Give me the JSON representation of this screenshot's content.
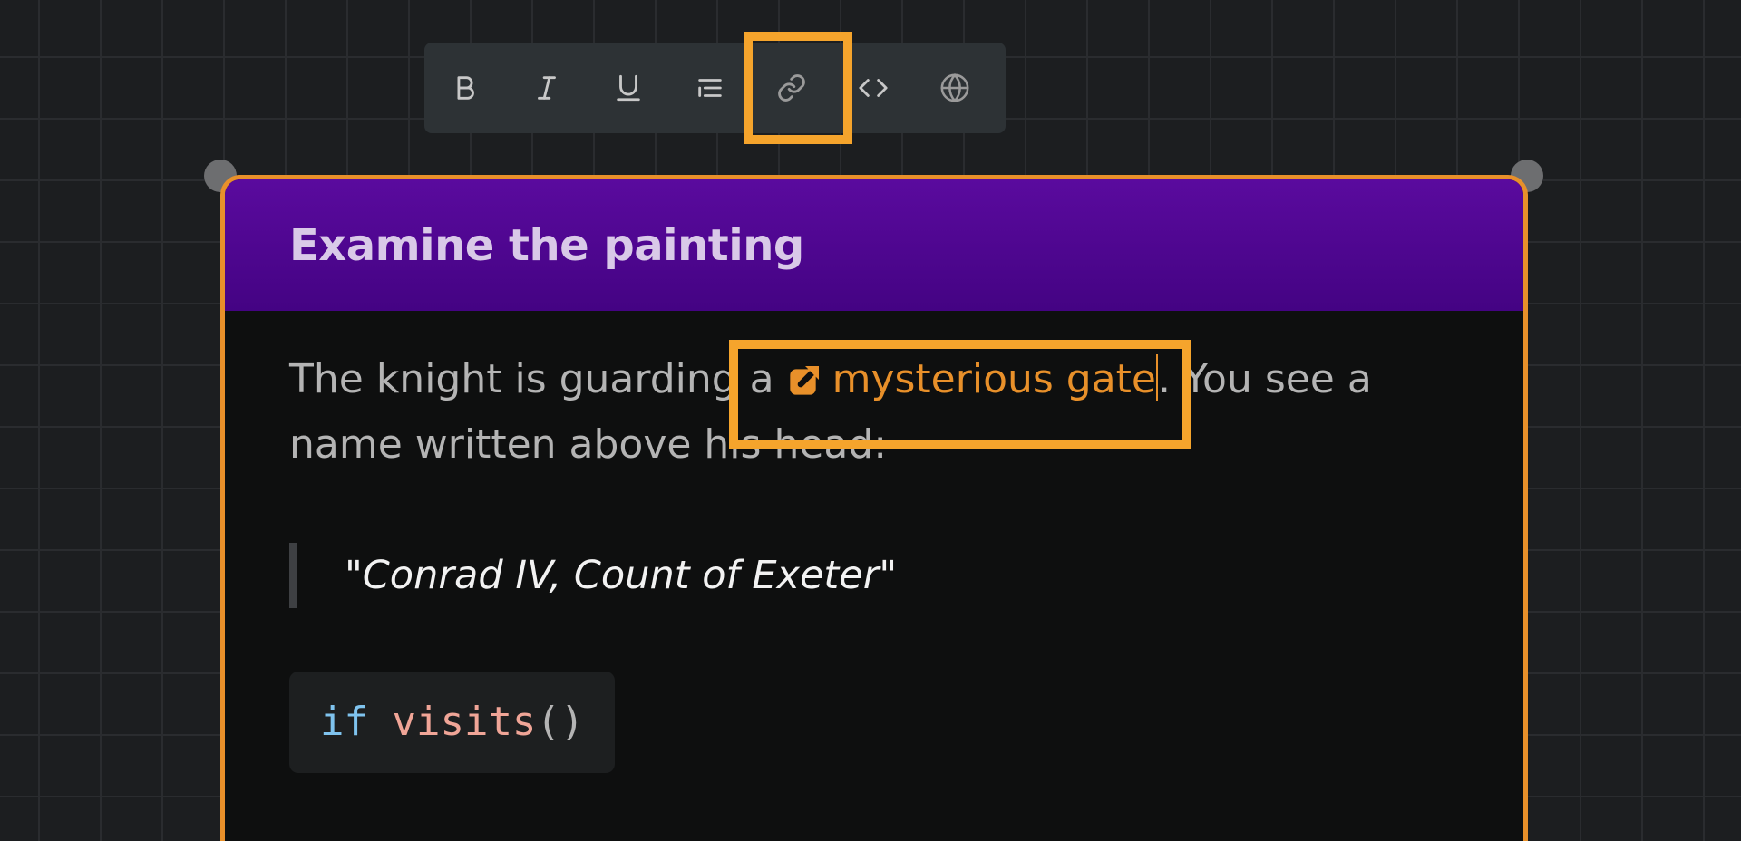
{
  "toolbar": {
    "buttons": [
      {
        "name": "bold-button",
        "icon": "bold-icon"
      },
      {
        "name": "italic-button",
        "icon": "italic-icon"
      },
      {
        "name": "underline-button",
        "icon": "underline-icon"
      },
      {
        "name": "list-button",
        "icon": "list-icon"
      },
      {
        "name": "link-button",
        "icon": "link-icon",
        "highlighted": true
      },
      {
        "name": "code-button",
        "icon": "code-icon"
      },
      {
        "name": "globe-button",
        "icon": "globe-icon"
      }
    ]
  },
  "node": {
    "title": "Examine the painting",
    "paragraph": {
      "before": "The knight is guarding a ",
      "link_icon": "external-link-icon",
      "link_text": "mysterious gate",
      "after": ". You see a name written above his head:"
    },
    "quote": "\"Conrad IV, Count of Exeter\"",
    "code": {
      "keyword": "if",
      "function": "visits",
      "parens": "()"
    }
  },
  "colors": {
    "accent": "#e8902a",
    "highlight": "#f5a42c",
    "header": "#4c0590",
    "background": "#1c1e20",
    "card": "#0e0f0f",
    "toolbar": "#2d3235"
  }
}
